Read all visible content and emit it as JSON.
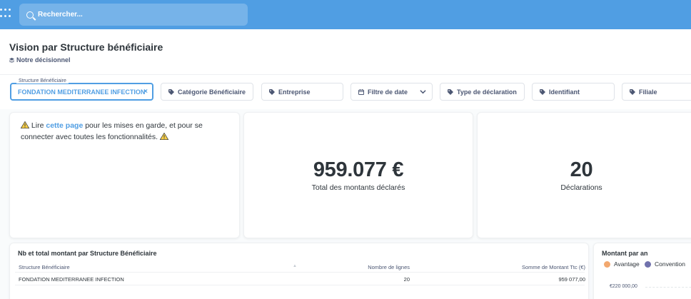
{
  "topbar": {
    "search_placeholder": "Rechercher..."
  },
  "header": {
    "title": "Vision par Structure bénéficiaire",
    "collection": "Notre décisionnel"
  },
  "filters": {
    "structure": {
      "legend": "Structure Bénéficiaire",
      "value": "FONDATION MEDITERRANEE INFECTION"
    },
    "categorie": "Catégorie Bénéficiaire",
    "entreprise": "Entreprise",
    "date": "Filtre de date",
    "type": "Type de déclaration",
    "identifiant": "Identifiant",
    "filiale": "Filiale"
  },
  "text_card": {
    "before_link": "Lire ",
    "link": "cette page",
    "after_link": " pour les mises en garde, et pour se connecter avec toutes les fonctionnalités."
  },
  "scalars": {
    "total": {
      "value": "959.077 €",
      "label": "Total des montants déclarés"
    },
    "declarations": {
      "value": "20",
      "label": "Déclarations"
    }
  },
  "table": {
    "title": "Nb et total montant par Structure Bénéficiaire",
    "columns": [
      "Structure Bénéficiaire",
      "Nombre de lignes",
      "Somme de Montant Ttc (€)"
    ],
    "rows": [
      [
        "FONDATION MEDITERRANEE INFECTION",
        "20",
        "959 077,00"
      ]
    ]
  },
  "chart": {
    "title": "Montant par an",
    "legend": [
      "Avantage",
      "Convention"
    ],
    "y_tick": "€220 000,00"
  },
  "colors": {
    "brand": "#509ee3",
    "avantage": "#f2a86f",
    "convention": "#7172ad",
    "warning": "#f9cf48"
  }
}
